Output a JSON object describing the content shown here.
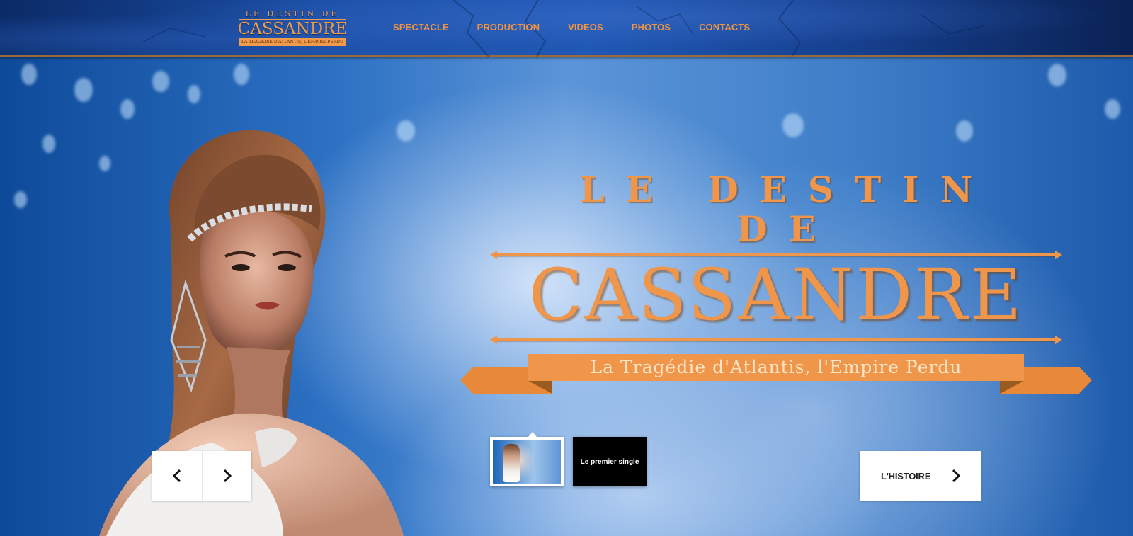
{
  "header": {
    "logo": {
      "line1": "LE DESTIN DE",
      "line2": "CASSANDRE",
      "ribbon": "LA TRAGÉDIE D'ATLANTIS, L'EMPIRE PERDU"
    },
    "nav": [
      {
        "label": "SPECTACLE",
        "icon": ""
      },
      {
        "label": "PRODUCTION",
        "icon": ""
      },
      {
        "label": "VIDEOS",
        "icon": ""
      },
      {
        "label": "PHOTOS",
        "icon": ""
      },
      {
        "label": "CONTACTS",
        "icon": ""
      }
    ]
  },
  "hero": {
    "title_line1": "LE DESTIN DE",
    "title_line2": "CASSANDRE",
    "banner": "La Tragédie d'Atlantis, l'Empire Perdu",
    "thumbnails": [
      {
        "label": "",
        "active": true
      },
      {
        "label": "Le premier single",
        "active": false
      }
    ],
    "cta_label": "L'HISTOIRE",
    "prev_icon": "chevron-left-icon",
    "next_icon": "chevron-right-icon"
  },
  "colors": {
    "accent": "#f0964a",
    "nav": "#f2943f",
    "header_bg": "#1a4ea6",
    "button_bg": "#ffffff"
  }
}
